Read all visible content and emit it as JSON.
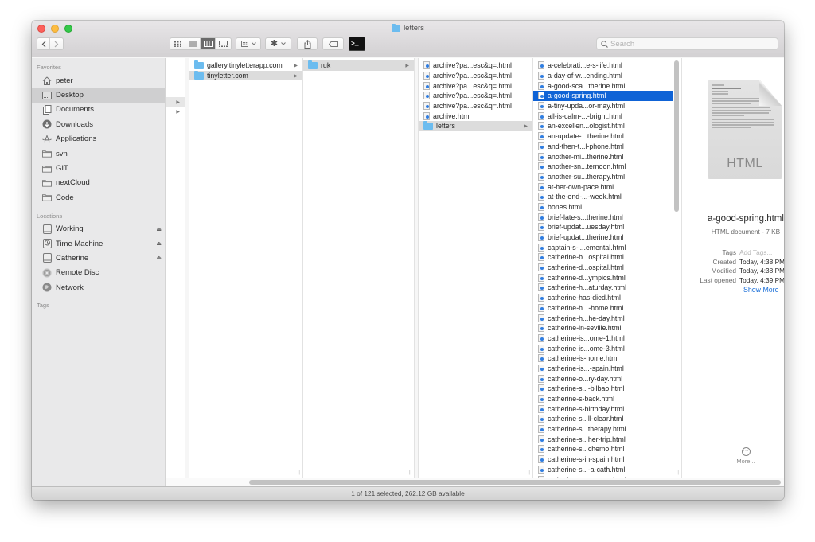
{
  "window": {
    "title": "letters",
    "title_icon": "folder-icon"
  },
  "toolbar": {
    "back_icon": "chevron-left-icon",
    "forward_icon": "chevron-right-icon",
    "view_modes": [
      {
        "name": "icon-view",
        "icon": "grid-icon",
        "active": false
      },
      {
        "name": "list-view",
        "icon": "list-icon",
        "active": false
      },
      {
        "name": "column-view",
        "icon": "columns-icon",
        "active": true
      },
      {
        "name": "gallery-view",
        "icon": "gallery-icon",
        "active": false
      }
    ],
    "group_icon": "group-by-icon",
    "action_icon": "gear-icon",
    "share_icon": "share-icon",
    "tag_icon": "tag-icon",
    "terminal_icon": "terminal-icon",
    "search_placeholder": "Search",
    "search_value": ""
  },
  "sidebar": {
    "favorites_label": "Favorites",
    "favorites": [
      {
        "label": "peter",
        "icon": "home-icon",
        "selected": false
      },
      {
        "label": "Desktop",
        "icon": "desktop-icon",
        "selected": true
      },
      {
        "label": "Documents",
        "icon": "documents-icon",
        "selected": false
      },
      {
        "label": "Downloads",
        "icon": "downloads-icon",
        "selected": false
      },
      {
        "label": "Applications",
        "icon": "applications-icon",
        "selected": false
      },
      {
        "label": "svn",
        "icon": "folder-icon",
        "selected": false
      },
      {
        "label": "GIT",
        "icon": "folder-icon",
        "selected": false
      },
      {
        "label": "nextCloud",
        "icon": "folder-icon",
        "selected": false
      },
      {
        "label": "Code",
        "icon": "folder-icon",
        "selected": false
      }
    ],
    "locations_label": "Locations",
    "locations": [
      {
        "label": "Working",
        "icon": "disk-icon",
        "eject": true
      },
      {
        "label": "Time Machine",
        "icon": "time-machine-icon",
        "eject": true
      },
      {
        "label": "Catherine",
        "icon": "disk-icon",
        "eject": true
      },
      {
        "label": "Remote Disc",
        "icon": "remote-disc-icon",
        "eject": false
      },
      {
        "label": "Network",
        "icon": "network-icon",
        "eject": false
      }
    ],
    "tags_label": "Tags"
  },
  "columns": {
    "col1": [
      {
        "label": "gallery.tinyletterapp.com",
        "type": "folder",
        "state": ""
      },
      {
        "label": "tinyletter.com",
        "type": "folder",
        "state": "path"
      }
    ],
    "col2": [
      {
        "label": "ruk",
        "type": "folder",
        "state": "path"
      }
    ],
    "col3": [
      {
        "label": "archive?pa...esc&q=.html",
        "type": "file",
        "state": ""
      },
      {
        "label": "archive?pa...esc&q=.html",
        "type": "file",
        "state": ""
      },
      {
        "label": "archive?pa...esc&q=.html",
        "type": "file",
        "state": ""
      },
      {
        "label": "archive?pa...esc&q=.html",
        "type": "file",
        "state": ""
      },
      {
        "label": "archive?pa...esc&q=.html",
        "type": "file",
        "state": ""
      },
      {
        "label": "archive.html",
        "type": "file",
        "state": ""
      },
      {
        "label": "letters",
        "type": "folder",
        "state": "path"
      }
    ],
    "col4": [
      {
        "label": "a-celebrati...e-s-life.html",
        "type": "file",
        "state": ""
      },
      {
        "label": "a-day-of-w...ending.html",
        "type": "file",
        "state": ""
      },
      {
        "label": "a-good-sca...therine.html",
        "type": "file",
        "state": ""
      },
      {
        "label": "a-good-spring.html",
        "type": "file",
        "state": "sel"
      },
      {
        "label": "a-tiny-upda...or-may.html",
        "type": "file",
        "state": ""
      },
      {
        "label": "all-is-calm-...-bright.html",
        "type": "file",
        "state": ""
      },
      {
        "label": "an-excellen...ologist.html",
        "type": "file",
        "state": ""
      },
      {
        "label": "an-update-...therine.html",
        "type": "file",
        "state": ""
      },
      {
        "label": "and-then-t...l-phone.html",
        "type": "file",
        "state": ""
      },
      {
        "label": "another-mi...therine.html",
        "type": "file",
        "state": ""
      },
      {
        "label": "another-sn...ternoon.html",
        "type": "file",
        "state": ""
      },
      {
        "label": "another-su...therapy.html",
        "type": "file",
        "state": ""
      },
      {
        "label": "at-her-own-pace.html",
        "type": "file",
        "state": ""
      },
      {
        "label": "at-the-end-...-week.html",
        "type": "file",
        "state": ""
      },
      {
        "label": "bones.html",
        "type": "file",
        "state": ""
      },
      {
        "label": "brief-late-s...therine.html",
        "type": "file",
        "state": ""
      },
      {
        "label": "brief-updat...uesday.html",
        "type": "file",
        "state": ""
      },
      {
        "label": "brief-updat...therine.html",
        "type": "file",
        "state": ""
      },
      {
        "label": "captain-s-l...emental.html",
        "type": "file",
        "state": ""
      },
      {
        "label": "catherine-b...ospital.html",
        "type": "file",
        "state": ""
      },
      {
        "label": "catherine-d...ospital.html",
        "type": "file",
        "state": ""
      },
      {
        "label": "catherine-d...ympics.html",
        "type": "file",
        "state": ""
      },
      {
        "label": "catherine-h...aturday.html",
        "type": "file",
        "state": ""
      },
      {
        "label": "catherine-has-died.html",
        "type": "file",
        "state": ""
      },
      {
        "label": "catherine-h...-home.html",
        "type": "file",
        "state": ""
      },
      {
        "label": "catherine-h...he-day.html",
        "type": "file",
        "state": ""
      },
      {
        "label": "catherine-in-seville.html",
        "type": "file",
        "state": ""
      },
      {
        "label": "catherine-is...ome-1.html",
        "type": "file",
        "state": ""
      },
      {
        "label": "catherine-is...ome-3.html",
        "type": "file",
        "state": ""
      },
      {
        "label": "catherine-is-home.html",
        "type": "file",
        "state": ""
      },
      {
        "label": "catherine-is...-spain.html",
        "type": "file",
        "state": ""
      },
      {
        "label": "catherine-o...ry-day.html",
        "type": "file",
        "state": ""
      },
      {
        "label": "catherine-s...-bilbao.html",
        "type": "file",
        "state": ""
      },
      {
        "label": "catherine-s-back.html",
        "type": "file",
        "state": ""
      },
      {
        "label": "catherine-s-birthday.html",
        "type": "file",
        "state": ""
      },
      {
        "label": "catherine-s...ll-clear.html",
        "type": "file",
        "state": ""
      },
      {
        "label": "catherine-s...therapy.html",
        "type": "file",
        "state": ""
      },
      {
        "label": "catherine-s...her-trip.html",
        "type": "file",
        "state": ""
      },
      {
        "label": "catherine-s...chemo.html",
        "type": "file",
        "state": ""
      },
      {
        "label": "catherine-s-in-spain.html",
        "type": "file",
        "state": ""
      },
      {
        "label": "catherine-s...-a-cath.html",
        "type": "file",
        "state": ""
      },
      {
        "label": "catherine-s...morrow.html",
        "type": "file",
        "state": ""
      }
    ]
  },
  "preview": {
    "thumbnail_label": "HTML",
    "file_name": "a-good-spring.html",
    "kind": "HTML document - 7 KB",
    "meta": [
      {
        "key": "Tags",
        "value": "Add Tags...",
        "placeholder": true
      },
      {
        "key": "Created",
        "value": "Today, 4:38 PM",
        "placeholder": false
      },
      {
        "key": "Modified",
        "value": "Today, 4:38 PM",
        "placeholder": false
      },
      {
        "key": "Last opened",
        "value": "Today, 4:39 PM",
        "placeholder": false
      }
    ],
    "show_more": "Show More",
    "more_label": "More...",
    "more_icon": "ellipsis-circle-icon"
  },
  "statusbar": {
    "text": "1 of 121 selected, 262.12 GB available"
  }
}
